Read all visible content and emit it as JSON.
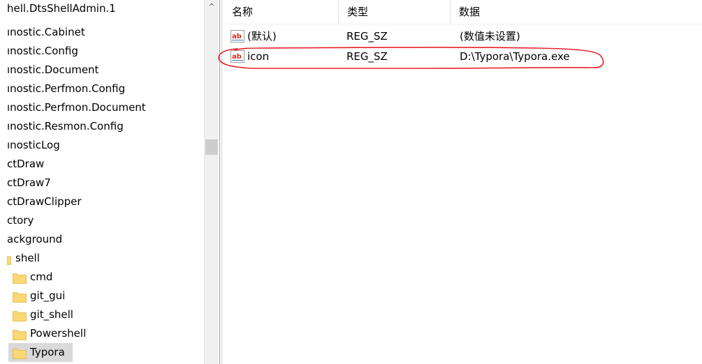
{
  "tree": {
    "items": [
      {
        "label": "hell.DtsShellAdmin.1"
      },
      {
        "label": "ınostic.Cabinet"
      },
      {
        "label": "ınostic.Config"
      },
      {
        "label": "ınostic.Document"
      },
      {
        "label": "ınostic.Perfmon.Config"
      },
      {
        "label": "ınostic.Perfmon.Document"
      },
      {
        "label": "ınostic.Resmon.Config"
      },
      {
        "label": "ınosticLog"
      },
      {
        "label": "ctDraw"
      },
      {
        "label": "ctDraw7"
      },
      {
        "label": "ctDrawClipper"
      },
      {
        "label": "ctory"
      },
      {
        "label": "ackground"
      },
      {
        "label": "shell"
      },
      {
        "label": "cmd"
      },
      {
        "label": "git_gui"
      },
      {
        "label": "git_shell"
      },
      {
        "label": "Powershell"
      },
      {
        "label": "Typora"
      }
    ],
    "selected_item": "Typora"
  },
  "scrollbar": {
    "up_arrow": "^"
  },
  "columns": {
    "name": "名称",
    "type": "类型",
    "data": "数据"
  },
  "values": [
    {
      "icon": "string-value-icon",
      "name": "(默认)",
      "type": "REG_SZ",
      "data": "(数值未设置)"
    },
    {
      "icon": "string-value-icon",
      "name": "icon",
      "type": "REG_SZ",
      "data": "D:\\Typora\\Typora.exe"
    }
  ],
  "colors": {
    "annotation": "#e8202a",
    "folder": "#f8d775",
    "folder_dark": "#e0b443",
    "selection": "#d9d9d9",
    "ab_icon_red": "#d62d20"
  }
}
